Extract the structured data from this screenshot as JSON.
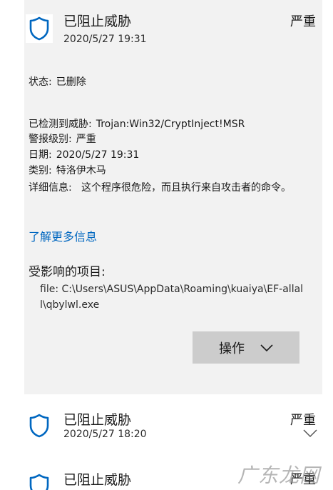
{
  "threats": [
    {
      "title": "已阻止威胁",
      "timestamp": "2020/5/27 19:31",
      "severity": "严重",
      "status_label": "状态:",
      "status_value": "已删除",
      "detected_label": "已检测到威胁:",
      "detected_value": "Trojan:Win32/CryptInject!MSR",
      "alert_level_label": "警报级别:",
      "alert_level_value": "严重",
      "date_label": "日期:",
      "date_value": "2020/5/27 19:31",
      "category_label": "类别:",
      "category_value": "特洛伊木马",
      "details_label": "详细信息:",
      "details_value": "这个程序很危险，而且执行来自攻击者的命令。",
      "learn_more": "了解更多信息",
      "affected_items_title": "受影响的项目:",
      "affected_item": "file: C:\\Users\\ASUS\\AppData\\Roaming\\kuaiya\\EF-allall\\qbylwl.exe",
      "action_label": "操作"
    },
    {
      "title": "已阻止威胁",
      "timestamp": "2020/5/27 18:20",
      "severity": "严重"
    },
    {
      "title": "已阻止威胁",
      "severity": "严重"
    }
  ],
  "watermark": "广东龙网",
  "colors": {
    "accent": "#0067c0",
    "card_background": "#f2f2f2",
    "button_background": "#cccccc"
  },
  "icons": {
    "threat": "shield-icon",
    "action": "chevron-down-icon",
    "expand": "chevron-down-icon"
  }
}
